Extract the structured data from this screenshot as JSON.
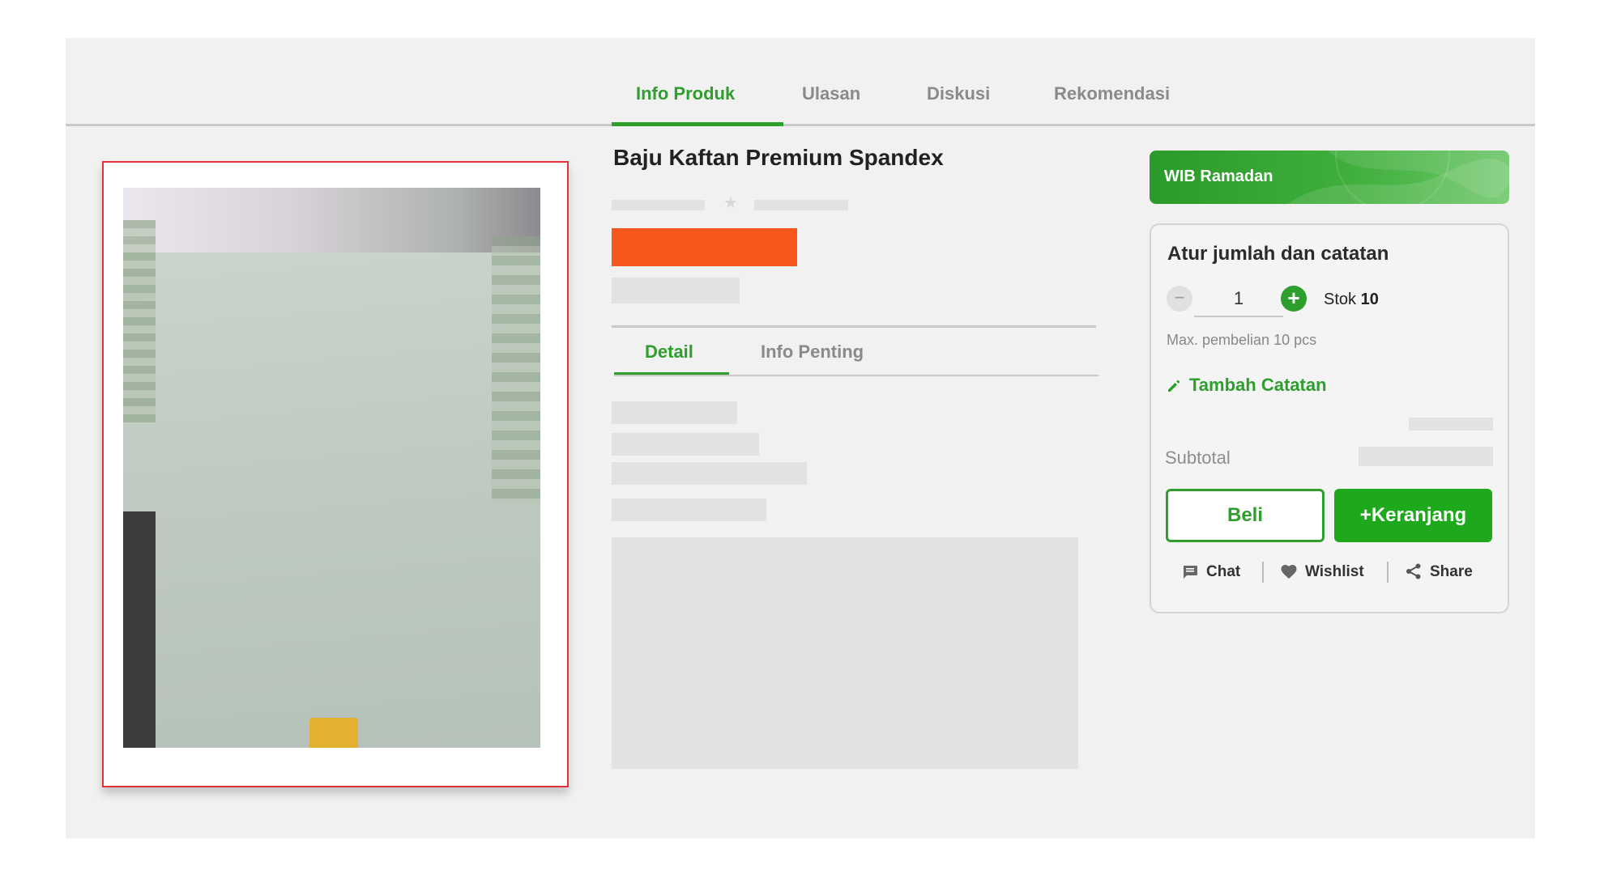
{
  "product_tabs": [
    {
      "label": "Info Produk",
      "active": true
    },
    {
      "label": "Ulasan",
      "active": false
    },
    {
      "label": "Diskusi",
      "active": false
    },
    {
      "label": "Rekomendasi",
      "active": false
    }
  ],
  "product": {
    "title": "Baju Kaftan Premium Spandex"
  },
  "detail_tabs": [
    {
      "label": "Detail",
      "active": true
    },
    {
      "label": "Info Penting",
      "active": false
    }
  ],
  "promo": {
    "label": "WIB Ramadan"
  },
  "purchase_box": {
    "title": "Atur jumlah dan catatan",
    "quantity": "1",
    "stock_label": "Stok",
    "stock_value": "10",
    "max_note": "Max. pembelian 10 pcs",
    "add_note_label": "Tambah Catatan",
    "subtotal_label": "Subtotal",
    "buy_label": "Beli",
    "cart_label": "+Keranjang"
  },
  "actions": [
    {
      "label": "Chat",
      "icon": "chat-icon"
    },
    {
      "label": "Wishlist",
      "icon": "heart-icon"
    },
    {
      "label": "Share",
      "icon": "share-icon"
    }
  ],
  "colors": {
    "accent_green": "#2e9e2c",
    "price_orange": "#f5581a",
    "image_border_red": "#e0343a"
  }
}
